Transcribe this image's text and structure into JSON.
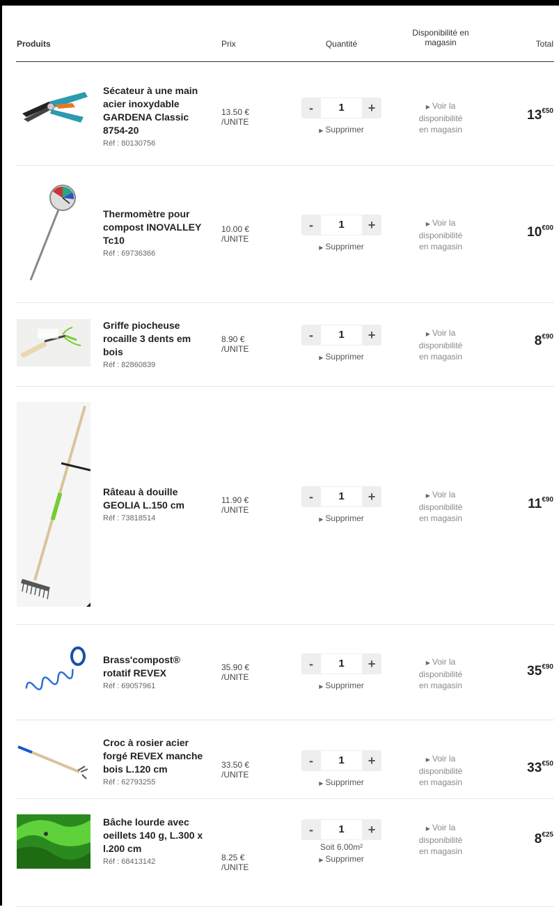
{
  "header": {
    "products": "Produits",
    "price": "Prix",
    "quantity": "Quantité",
    "availability_line1": "Disponibilité en",
    "availability_line2": "magasin",
    "total": "Total"
  },
  "common": {
    "remove_label": "Supprimer",
    "availability_line1": "Voir la",
    "availability_line2": "disponibilité",
    "availability_line3": "en magasin",
    "minus": "-",
    "plus": "+"
  },
  "products": [
    {
      "name": "Sécateur à une main acier inoxydable GARDENA Classic 8754-20",
      "ref": "Réf : 80130756",
      "price": "13.50 €",
      "unit": "/UNITE",
      "qty": "1",
      "total_int": "13",
      "total_dec": "€50",
      "image": "pruner-image"
    },
    {
      "name": "Thermomètre pour compost INOVALLEY Tc10",
      "ref": "Réf : 69736366",
      "price": "10.00 €",
      "unit": "/UNITE",
      "qty": "1",
      "total_int": "10",
      "total_dec": "€00",
      "image": "thermometer-image"
    },
    {
      "name": "Griffe piocheuse rocaille 3 dents em bois",
      "ref": "Réf : 82860839",
      "price": "8.90 €",
      "unit": "/UNITE",
      "qty": "1",
      "total_int": "8",
      "total_dec": "€90",
      "image": "hand-cultivator-image"
    },
    {
      "name": "Râteau à douille GEOLIA L.150 cm",
      "ref": "Réf : 73818514",
      "price": "11.90 €",
      "unit": "/UNITE",
      "qty": "1",
      "total_int": "11",
      "total_dec": "€90",
      "image": "rake-image"
    },
    {
      "name": "Brass'compost® rotatif REVEX",
      "ref": "Réf : 69057961",
      "price": "35.90 €",
      "unit": "/UNITE",
      "qty": "1",
      "total_int": "35",
      "total_dec": "€90",
      "image": "compost-aerator-image"
    },
    {
      "name": "Croc à rosier acier forgé REVEX manche bois L.120 cm",
      "ref": "Réf : 62793255",
      "price": "33.50 €",
      "unit": "/UNITE",
      "qty": "1",
      "total_int": "33",
      "total_dec": "€50",
      "image": "rose-hoe-image"
    },
    {
      "name": "Bâche lourde avec oeillets 140 g, L.300 x l.200 cm",
      "ref": "Réf : 68413142",
      "price": "8.25 €",
      "unit": "/UNITE",
      "qty": "1",
      "soit": "Soit 6.00m²",
      "total_int": "8",
      "total_dec": "€25",
      "image": "tarp-image"
    }
  ]
}
